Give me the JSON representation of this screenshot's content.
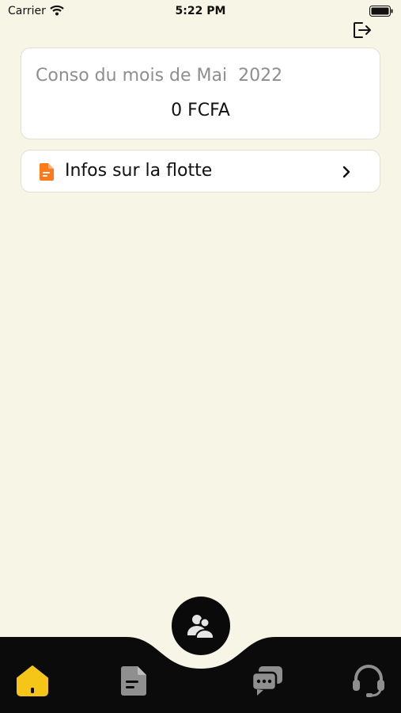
{
  "status_bar": {
    "carrier": "Carrier",
    "time": "5:22 PM"
  },
  "conso": {
    "title": "Conso du mois de Mai  2022",
    "amount": "0 FCFA"
  },
  "infos": {
    "label": "Infos sur la flotte"
  },
  "icons": {
    "logout": "logout-icon",
    "infos": "document-icon",
    "chevron": "chevron-right-icon",
    "center": "users-icon",
    "home": "home-icon",
    "docs": "document-icon",
    "chat": "chat-icon",
    "support": "headset-icon"
  },
  "colors": {
    "background": "#f7f5e6",
    "accent": "#ff7a1a",
    "active_tab": "#f5c518",
    "tabbar": "#0b0b0b",
    "inactive_tab": "#8f8f8f"
  }
}
